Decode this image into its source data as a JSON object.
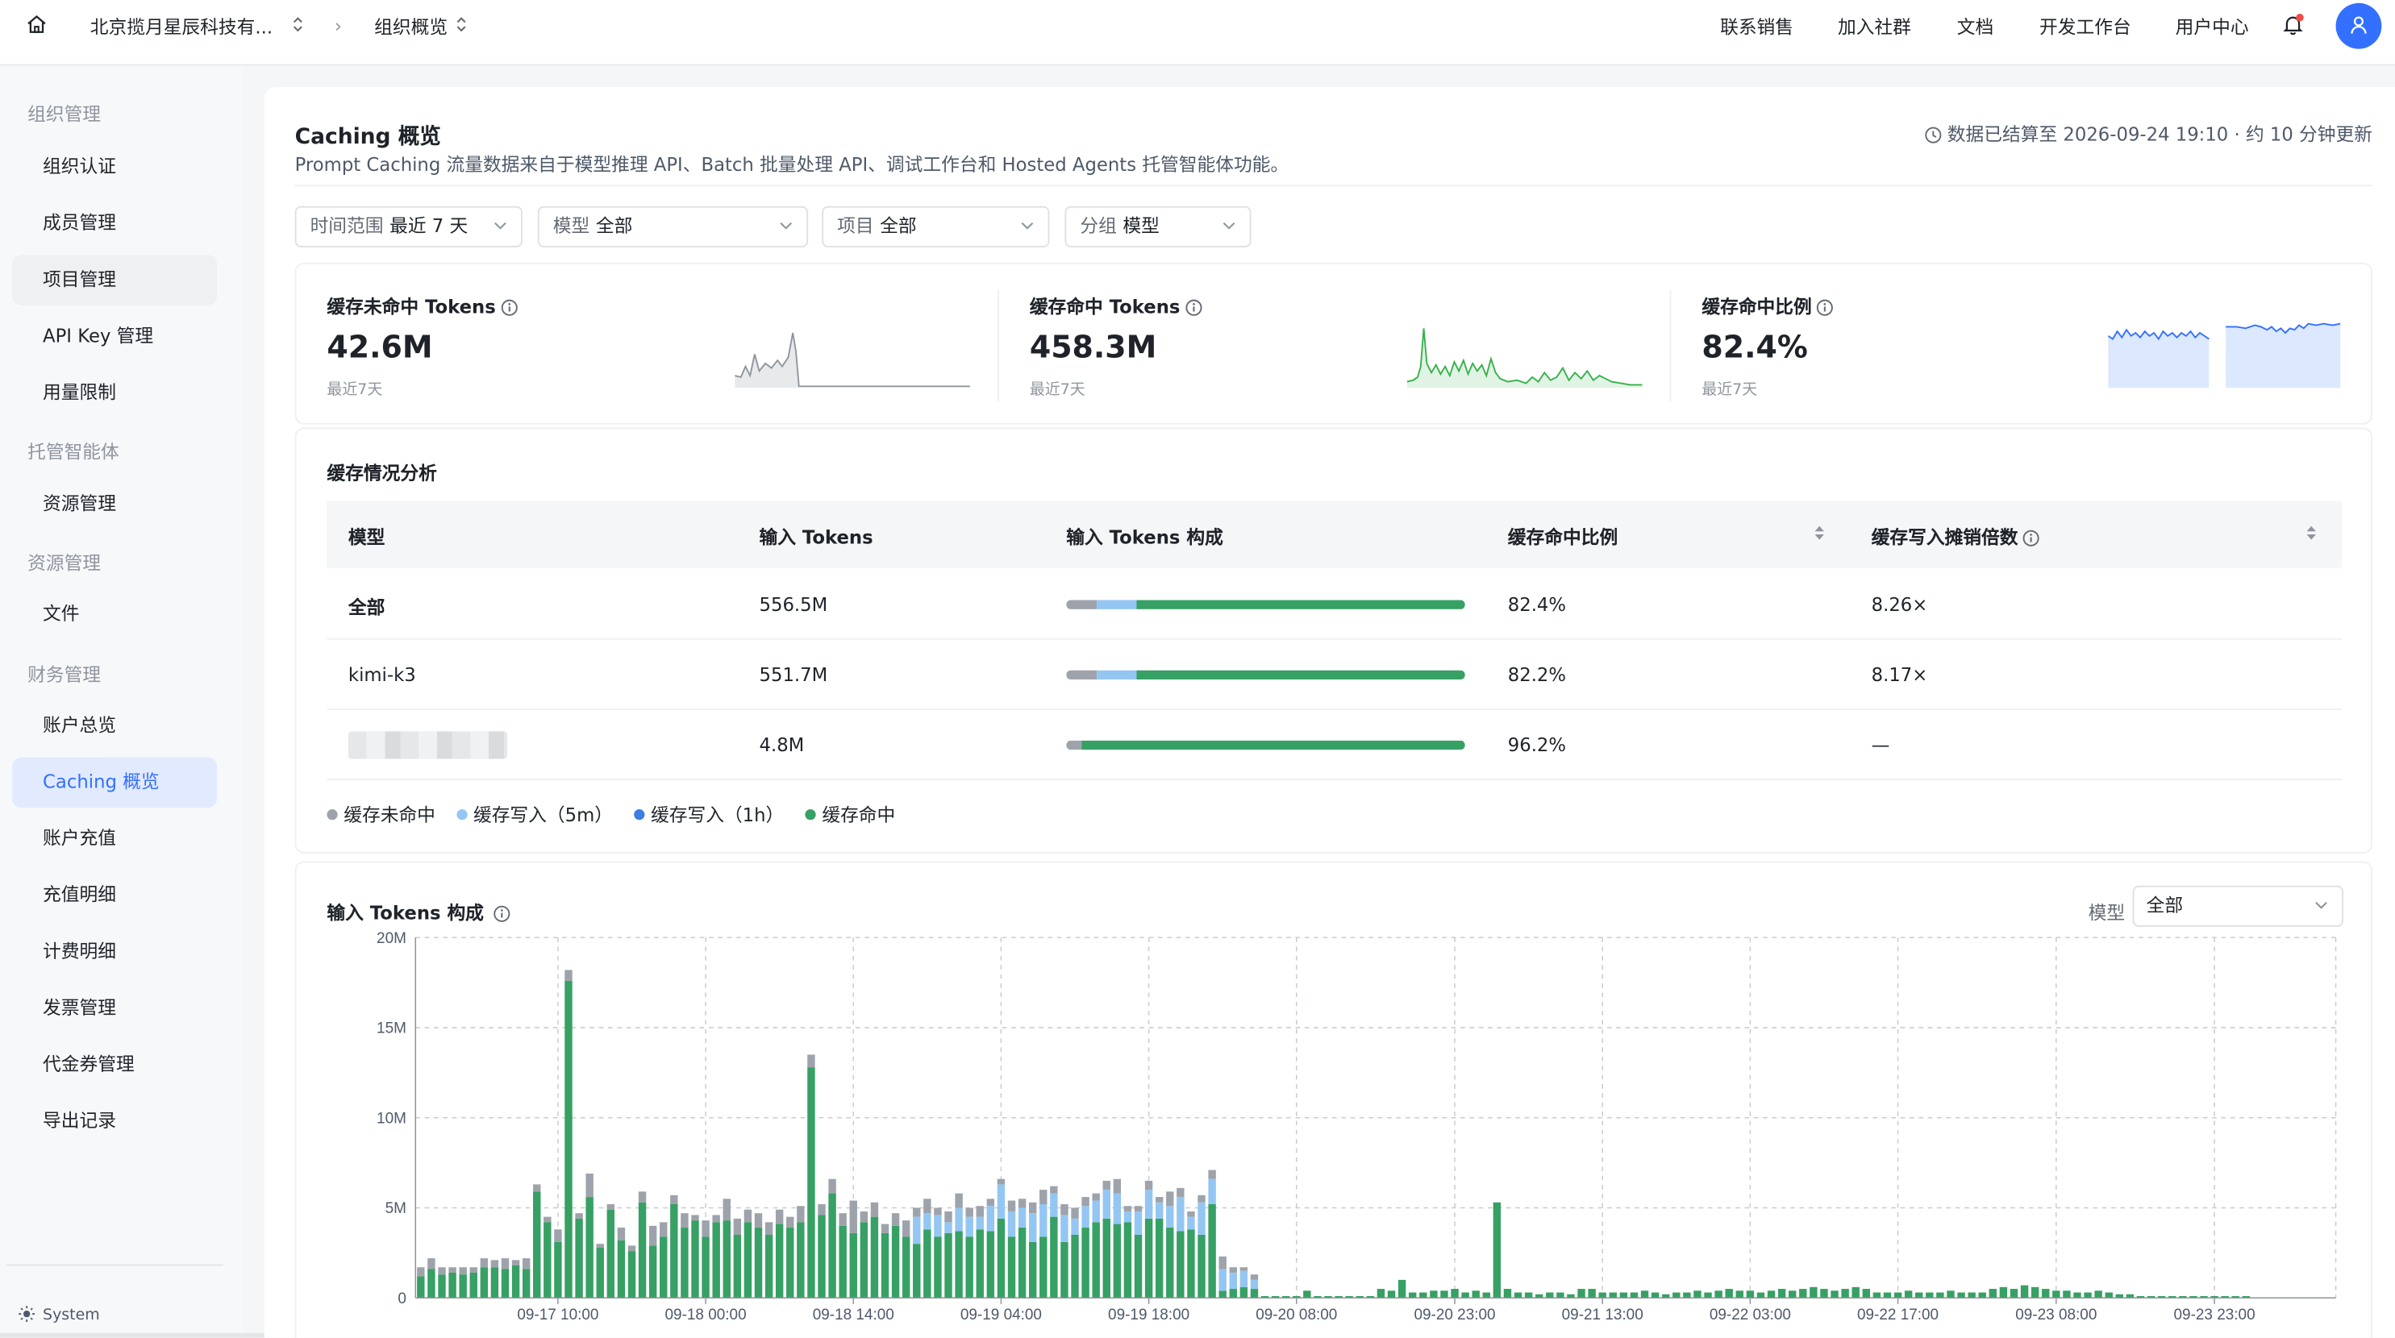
{
  "topbar": {
    "org_name": "北京揽月星辰科技有...",
    "page": "组织概览",
    "nav": [
      "联系销售",
      "加入社群",
      "文档",
      "开发工作台",
      "用户中心"
    ]
  },
  "sidebar": {
    "groups": [
      {
        "label": "组织管理",
        "items": [
          "组织认证",
          "成员管理",
          "项目管理",
          "API Key 管理",
          "用量限制"
        ]
      },
      {
        "label": "托管智能体",
        "items": [
          "资源管理"
        ]
      },
      {
        "label": "资源管理",
        "items": [
          "文件"
        ]
      },
      {
        "label": "财务管理",
        "items": [
          "账户总览",
          "Caching 概览",
          "账户充值",
          "充值明细",
          "计费明细",
          "发票管理",
          "代金券管理",
          "导出记录"
        ]
      }
    ],
    "active_item": "Caching 概览",
    "system_label": "System"
  },
  "header": {
    "title": "Caching 概览",
    "subtitle": "Prompt Caching 流量数据来自于模型推理 API、Batch 批量处理 API、调试工作台和 Hosted Agents 托管智能体功能。",
    "updated": "数据已结算至 2026-09-24 19:10 · 约 10 分钟更新"
  },
  "filters": [
    {
      "label": "时间范围",
      "value": "最近 7 天"
    },
    {
      "label": "模型",
      "value": "全部"
    },
    {
      "label": "项目",
      "value": "全部"
    },
    {
      "label": "分组",
      "value": "模型"
    }
  ],
  "kpis": [
    {
      "label": "缓存未命中 Tokens",
      "value": "42.6M",
      "sub": "最近7天"
    },
    {
      "label": "缓存命中 Tokens",
      "value": "458.3M",
      "sub": "最近7天"
    },
    {
      "label": "缓存命中比例",
      "value": "82.4%",
      "sub": "最近7天"
    }
  ],
  "table": {
    "title": "缓存情况分析",
    "columns": [
      "模型",
      "输入 Tokens",
      "输入 Tokens 构成",
      "缓存命中比例",
      "缓存写入摊销倍数"
    ],
    "rows": [
      {
        "model": "全部",
        "tokens": "556.5M",
        "composition": [
          0.076,
          0.1,
          0.0,
          0.824
        ],
        "hit_ratio": "82.4%",
        "multiplier": "8.26×"
      },
      {
        "model": "kimi-k3",
        "tokens": "551.7M",
        "composition": [
          0.077,
          0.101,
          0.0,
          0.822
        ],
        "hit_ratio": "82.2%",
        "multiplier": "8.17×"
      },
      {
        "model": "",
        "tokens": "4.8M",
        "composition": [
          0.038,
          0.0,
          0.0,
          0.962
        ],
        "hit_ratio": "96.2%",
        "multiplier": "—"
      }
    ],
    "legend": [
      {
        "name": "缓存未命中",
        "color": "#9ea3ab"
      },
      {
        "name": "缓存写入（5m）",
        "color": "#94c6f3"
      },
      {
        "name": "缓存写入（1h）",
        "color": "#3d7fe0"
      },
      {
        "name": "缓存命中",
        "color": "#37a064"
      }
    ]
  },
  "chart_section": {
    "title": "输入 Tokens 构成",
    "model_label": "模型",
    "model_value": "全部"
  },
  "colors": {
    "accent": "#3370ff",
    "miss": "#9ea3ab",
    "write5m": "#94c6f3",
    "write1h": "#3d7fe0",
    "hit": "#37a064"
  },
  "chart_data": {
    "type": "bar",
    "stacked": true,
    "ylim": [
      0,
      20
    ],
    "yticks": [
      "0",
      "5M",
      "10M",
      "15M",
      "20M"
    ],
    "xticks": [
      "09-17 10:00",
      "09-18 00:00",
      "09-18 14:00",
      "09-19 04:00",
      "09-19 18:00",
      "09-20 08:00",
      "09-20 23:00",
      "09-21 13:00",
      "09-22 03:00",
      "09-22 17:00",
      "09-23 08:00",
      "09-23 23:00"
    ],
    "xtick_index": [
      13,
      27,
      41,
      55,
      69,
      83,
      98,
      112,
      126,
      140,
      155,
      170
    ],
    "series": [
      {
        "name": "缓存未命中",
        "color": "#9ea3ab",
        "values": [
          0.5,
          0.6,
          0.4,
          0.3,
          0.4,
          0.3,
          0.5,
          0.4,
          0.6,
          0.3,
          0.6,
          0.4,
          0.3,
          0.7,
          0.6,
          0.3,
          1.3,
          0.2,
          0.3,
          0.7,
          0.3,
          0.6,
          1.1,
          0.8,
          0.5,
          0.8,
          0.3,
          0.9,
          0.4,
          1.2,
          0.9,
          0.7,
          0.8,
          0.7,
          0.8,
          0.6,
          0.9,
          0.7,
          0.6,
          0.8,
          0.7,
          1.8,
          0.6,
          0.8,
          0.5,
          0.7,
          0.9,
          0.5,
          0.8,
          0.4,
          0.6,
          0.8,
          0.5,
          0.6,
          0.4,
          0.3,
          0.6,
          0.5,
          0.6,
          0.8,
          0.4,
          0.6,
          0.6,
          0.5,
          0.4,
          0.5,
          0.8,
          0.3,
          0.3,
          0.5,
          0.3,
          0.8,
          0.5,
          0.3,
          0.4,
          0.5,
          0.7,
          0.3,
          0.2,
          0.3,
          0,
          0,
          0,
          0,
          0,
          0,
          0,
          0,
          0,
          0,
          0,
          0,
          0,
          0,
          0,
          0,
          0,
          0,
          0,
          0,
          0,
          0,
          0,
          0,
          0,
          0,
          0,
          0,
          0,
          0,
          0,
          0,
          0,
          0,
          0,
          0,
          0,
          0,
          0,
          0,
          0,
          0,
          0,
          0,
          0,
          0,
          0,
          0,
          0,
          0,
          0,
          0,
          0,
          0,
          0,
          0,
          0,
          0,
          0,
          0,
          0,
          0,
          0,
          0,
          0,
          0,
          0,
          0,
          0,
          0,
          0,
          0,
          0,
          0,
          0,
          0,
          0,
          0,
          0,
          0,
          0,
          0,
          0,
          0,
          0,
          0,
          0,
          0,
          0,
          0,
          0,
          0,
          0,
          0,
          0,
          0,
          0,
          0,
          0,
          0,
          0,
          0
        ]
      },
      {
        "name": "缓存写入（5m）",
        "color": "#94c6f3",
        "values": [
          0,
          0,
          0,
          0,
          0,
          0,
          0,
          0,
          0,
          0,
          0,
          0,
          0,
          0,
          0,
          0,
          0,
          0,
          0,
          0,
          0,
          0,
          0,
          0,
          0,
          0,
          0,
          0,
          0,
          0,
          0,
          0,
          0,
          0,
          0,
          0,
          0,
          0,
          0,
          0,
          0,
          0,
          0,
          0,
          0,
          0,
          0,
          1.5,
          0.9,
          1.2,
          0.6,
          1.3,
          1.1,
          0.7,
          1.4,
          1.9,
          1.4,
          1.1,
          1.6,
          1.8,
          1.3,
          1.5,
          0.9,
          1.2,
          1.2,
          1.6,
          1.7,
          0.6,
          1.3,
          1.6,
          0.9,
          1.2,
          1.9,
          0.7,
          1.8,
          1.4,
          1.2,
          0.9,
          0.9,
          0.5,
          0,
          0,
          0,
          0,
          0,
          0,
          0,
          0,
          0,
          0,
          0,
          0,
          0,
          0,
          0,
          0,
          0,
          0,
          0,
          0,
          0,
          0,
          0,
          0,
          0,
          0,
          0,
          0,
          0,
          0,
          0,
          0,
          0,
          0,
          0,
          0,
          0,
          0,
          0,
          0,
          0,
          0,
          0,
          0,
          0,
          0,
          0,
          0,
          0,
          0,
          0,
          0,
          0,
          0,
          0,
          0,
          0,
          0,
          0,
          0,
          0,
          0,
          0,
          0,
          0,
          0,
          0,
          0,
          0,
          0,
          0,
          0,
          0,
          0,
          0,
          0,
          0,
          0,
          0,
          0,
          0,
          0,
          0,
          0,
          0,
          0,
          0,
          0,
          0,
          0,
          0,
          0,
          0,
          0,
          0,
          0,
          0,
          0,
          0,
          0,
          0,
          0
        ]
      },
      {
        "name": "缓存写入（1h）",
        "color": "#3d7fe0",
        "values": [
          0,
          0,
          0,
          0,
          0,
          0,
          0,
          0,
          0,
          0,
          0,
          0,
          0,
          0,
          0,
          0,
          0,
          0,
          0,
          0,
          0,
          0,
          0,
          0,
          0,
          0,
          0,
          0,
          0,
          0,
          0,
          0,
          0,
          0,
          0,
          0,
          0,
          0,
          0,
          0,
          0,
          0,
          0,
          0,
          0,
          0,
          0,
          0,
          0,
          0,
          0,
          0,
          0,
          0,
          0,
          0,
          0,
          0,
          0,
          0,
          0,
          0,
          0,
          0,
          0,
          0,
          0,
          0,
          0,
          0,
          0,
          0,
          0,
          0,
          0,
          0,
          0,
          0,
          0,
          0,
          0,
          0,
          0,
          0,
          0,
          0,
          0,
          0,
          0,
          0,
          0,
          0,
          0,
          0,
          0,
          0,
          0,
          0,
          0,
          0,
          0,
          0,
          0,
          0,
          0,
          0,
          0,
          0,
          0,
          0,
          0,
          0,
          0,
          0,
          0,
          0,
          0,
          0,
          0,
          0,
          0,
          0,
          0,
          0,
          0,
          0,
          0,
          0,
          0,
          0,
          0,
          0,
          0,
          0,
          0,
          0,
          0,
          0,
          0,
          0,
          0,
          0,
          0,
          0,
          0,
          0,
          0,
          0,
          0,
          0,
          0,
          0,
          0,
          0,
          0,
          0,
          0,
          0,
          0,
          0,
          0,
          0,
          0,
          0,
          0,
          0,
          0,
          0,
          0,
          0,
          0,
          0,
          0,
          0
        ]
      },
      {
        "name": "缓存命中",
        "color": "#37a064",
        "values": [
          1.2,
          1.6,
          1.3,
          1.4,
          1.3,
          1.4,
          1.7,
          1.7,
          1.6,
          1.8,
          1.6,
          5.9,
          4.2,
          3.1,
          17.6,
          4.4,
          5.6,
          2.8,
          4.9,
          3.2,
          2.6,
          5.3,
          2.9,
          3.4,
          5.2,
          3.9,
          4.3,
          3.4,
          4.2,
          4.3,
          3.5,
          4.2,
          3.9,
          3.5,
          4.1,
          3.9,
          4.2,
          12.8,
          4.6,
          5.8,
          4.0,
          3.6,
          4.2,
          4.5,
          3.6,
          4.0,
          3.4,
          3.0,
          3.8,
          3.4,
          3.6,
          3.7,
          3.4,
          3.8,
          3.7,
          4.4,
          3.4,
          3.9,
          3.1,
          3.4,
          4.5,
          3.1,
          3.5,
          3.9,
          4.2,
          4.4,
          4.1,
          4.2,
          3.5,
          4.4,
          4.4,
          3.9,
          3.7,
          3.8,
          3.5,
          5.2,
          0.4,
          0.5,
          0.6,
          0.5,
          0.1,
          0.1,
          0.1,
          0.1,
          0.4,
          0.1,
          0.1,
          0.1,
          0.1,
          0.1,
          0.1,
          0.5,
          0.4,
          1.0,
          0.3,
          0.3,
          0.4,
          0.4,
          0.5,
          0.3,
          0.4,
          0.3,
          5.3,
          0.5,
          0.3,
          0.3,
          0.2,
          0.3,
          0.3,
          0.2,
          0.5,
          0.5,
          0.3,
          0.3,
          0.3,
          0.3,
          0.4,
          0.3,
          0.2,
          0.3,
          0.3,
          0.4,
          0.3,
          0.4,
          0.5,
          0.4,
          0.4,
          0.3,
          0.4,
          0.5,
          0.4,
          0.5,
          0.6,
          0.5,
          0.4,
          0.5,
          0.6,
          0.5,
          0.3,
          0.3,
          0.3,
          0.4,
          0.3,
          0.3,
          0.3,
          0.4,
          0.3,
          0.3,
          0.3,
          0.5,
          0.6,
          0.5,
          0.7,
          0.6,
          0.5,
          0.4,
          0.4,
          0.3,
          0.3,
          0.4,
          0.3,
          0.2,
          0.2,
          0.1,
          0.1,
          0.1,
          0.1,
          0.1,
          0.1,
          0.1,
          0.1,
          0.1,
          0.1,
          0.1
        ]
      }
    ]
  }
}
